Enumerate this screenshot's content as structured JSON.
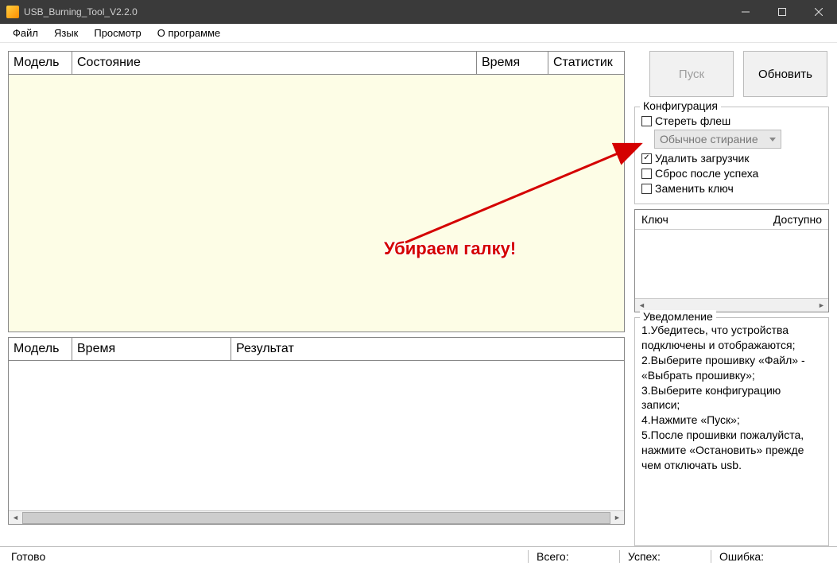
{
  "window": {
    "title": "USB_Burning_Tool_V2.2.0"
  },
  "menu": {
    "file": "Файл",
    "lang": "Язык",
    "view": "Просмотр",
    "about": "О программе"
  },
  "main_table": {
    "col_model": "Модель",
    "col_state": "Состояние",
    "col_time": "Время",
    "col_stats": "Статистик"
  },
  "result_table": {
    "col_model": "Модель",
    "col_time": "Время",
    "col_result": "Результат"
  },
  "buttons": {
    "start": "Пуск",
    "refresh": "Обновить"
  },
  "config": {
    "title": "Конфигурация",
    "erase_flash": "Стереть флеш",
    "erase_mode": "Обычное стирание",
    "erase_bootloader": "Удалить загрузчик",
    "reset_after": "Сброс после успеха",
    "replace_key": "Заменить ключ"
  },
  "key_panel": {
    "col_key": "Ключ",
    "col_avail": "Доступно"
  },
  "notice": {
    "title": "Уведомление",
    "text": "1.Убедитесь, что устройства подключены и отображаются;\n2.Выберите прошивку «Файл» - «Выбрать прошивку»;\n3.Выберите конфигурацию записи;\n4.Нажмите «Пуск»;\n5.После прошивки пожалуйста, нажмите «Остановить» прежде чем отключать usb."
  },
  "status": {
    "ready": "Готово",
    "total": "Всего:",
    "success": "Успех:",
    "error": "Ошибка:"
  },
  "annotation": {
    "text": "Убираем галку!"
  }
}
